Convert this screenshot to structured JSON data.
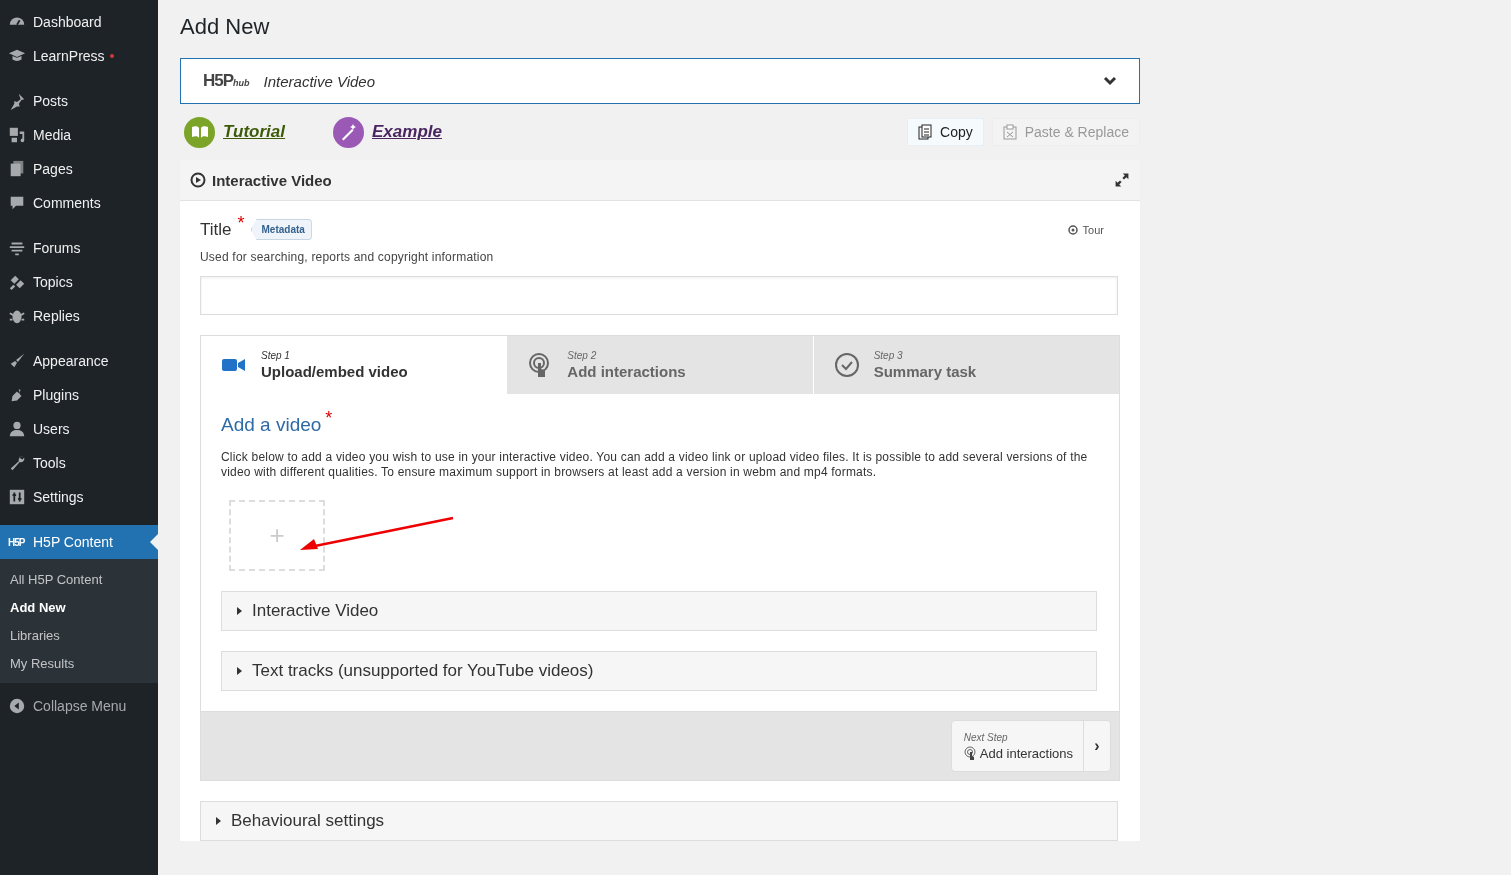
{
  "sidebar": {
    "groups": [
      [
        {
          "label": "Dashboard",
          "dot": false,
          "selected": false
        },
        {
          "label": "LearnPress",
          "dot": true,
          "selected": false
        }
      ],
      [
        {
          "label": "Posts",
          "dot": false,
          "selected": false
        },
        {
          "label": "Media",
          "dot": false,
          "selected": false
        },
        {
          "label": "Pages",
          "dot": false,
          "selected": false
        },
        {
          "label": "Comments",
          "dot": false,
          "selected": false
        }
      ],
      [
        {
          "label": "Forums",
          "dot": false,
          "selected": false
        },
        {
          "label": "Topics",
          "dot": false,
          "selected": false
        },
        {
          "label": "Replies",
          "dot": false,
          "selected": false
        }
      ],
      [
        {
          "label": "Appearance",
          "dot": false,
          "selected": false
        },
        {
          "label": "Plugins",
          "dot": false,
          "selected": false
        },
        {
          "label": "Users",
          "dot": false,
          "selected": false
        },
        {
          "label": "Tools",
          "dot": false,
          "selected": false
        },
        {
          "label": "Settings",
          "dot": false,
          "selected": false
        }
      ]
    ],
    "current": {
      "logo": "H5P",
      "label": "H5P Content",
      "selected": true
    },
    "submenu": [
      {
        "label": "All H5P Content",
        "selected": false
      },
      {
        "label": "Add New",
        "selected": true
      },
      {
        "label": "Libraries",
        "selected": false
      },
      {
        "label": "My Results",
        "selected": false
      }
    ],
    "collapse": "Collapse Menu"
  },
  "page_title": "Add New",
  "hub": {
    "logo": "H5P",
    "logo_suffix": "hub",
    "content_type": "Interactive Video",
    "expanded": false
  },
  "links": [
    {
      "label": "Tutorial",
      "color": "#7ba428"
    },
    {
      "label": "Example",
      "color": "#9b59b6"
    }
  ],
  "clipboard": [
    {
      "label": "Copy",
      "disabled": false
    },
    {
      "label": "Paste & Replace",
      "disabled": true
    }
  ],
  "editor": {
    "title": "Interactive Video",
    "title_field": {
      "label": "Title",
      "required": true,
      "required_mark": "*",
      "metadata": "Metadata",
      "tour": "Tour",
      "description": "Used for searching, reports and copyright information"
    },
    "steps": [
      {
        "step": "Step 1",
        "label": "Upload/embed video",
        "selected": true
      },
      {
        "step": "Step 2",
        "label": "Add interactions",
        "selected": false
      },
      {
        "step": "Step 3",
        "label": "Summary task",
        "selected": false
      }
    ],
    "add_video": {
      "heading": "Add a video",
      "required": true,
      "required_mark": "*",
      "description": "Click below to add a video you wish to use in your interactive video. You can add a video link or upload video files. It is possible to add several versions of the video with different qualities. To ensure maximum support in browsers at least add a version in webm and mp4 formats.",
      "add_symbol": "+"
    },
    "groups": [
      {
        "label": "Interactive Video",
        "expanded": false
      },
      {
        "label": "Text tracks (unsupported for YouTube videos)",
        "expanded": false
      }
    ],
    "next_step": {
      "caption": "Next Step",
      "label": "Add interactions",
      "arrow": "›"
    },
    "behavioural": {
      "label": "Behavioural settings",
      "expanded": false
    }
  }
}
